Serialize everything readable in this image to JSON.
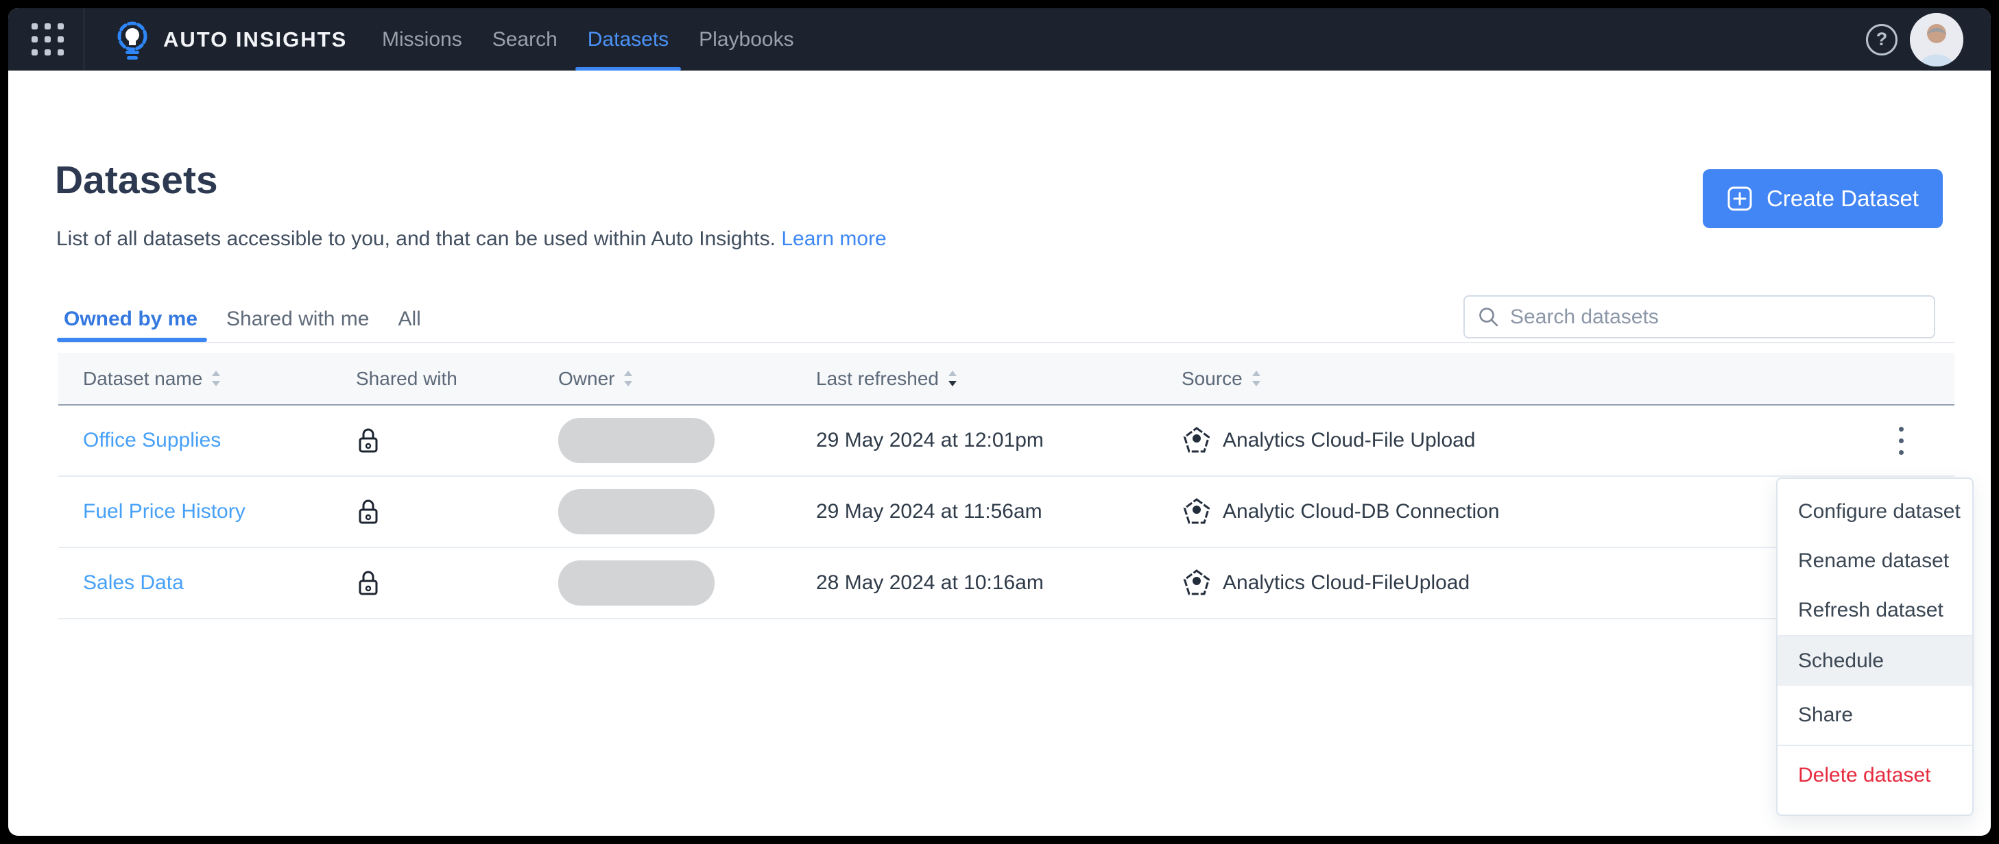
{
  "navbar": {
    "brand": "AUTO INSIGHTS",
    "items": [
      {
        "label": "Missions",
        "active": false
      },
      {
        "label": "Search",
        "active": false
      },
      {
        "label": "Datasets",
        "active": true
      },
      {
        "label": "Playbooks",
        "active": false
      }
    ],
    "icons": {
      "launcher": "grid-dots",
      "logo": "lightbulb",
      "help": "question-circle",
      "avatar": "user-photo"
    }
  },
  "page": {
    "title": "Datasets",
    "subtitle": "List of all datasets accessible to you, and that can be used within Auto Insights.",
    "learn_more_label": "Learn more",
    "create_button_label": "Create Dataset",
    "create_button_icon": "plus-square"
  },
  "tabs": [
    {
      "label": "Owned by me",
      "active": true
    },
    {
      "label": "Shared with me",
      "active": false
    },
    {
      "label": "All",
      "active": false
    }
  ],
  "search": {
    "placeholder": "Search datasets",
    "icon": "magnifier"
  },
  "table": {
    "columns": [
      {
        "label": "Dataset name",
        "sortable": true,
        "sort": "none"
      },
      {
        "label": "Shared with",
        "sortable": false,
        "sort": "none"
      },
      {
        "label": "Owner",
        "sortable": true,
        "sort": "none"
      },
      {
        "label": "Last refreshed",
        "sortable": true,
        "sort": "desc"
      },
      {
        "label": "Source",
        "sortable": true,
        "sort": "none"
      }
    ],
    "rows": [
      {
        "name": "Office Supplies",
        "shared_icon": "lock",
        "owner_redacted": true,
        "last_refreshed": "29 May 2024 at 12:01pm",
        "source_icon": "pentagon",
        "source": "Analytics Cloud-File Upload",
        "actions_icon": "kebab-vertical"
      },
      {
        "name": "Fuel Price History",
        "shared_icon": "lock",
        "owner_redacted": true,
        "last_refreshed": "29 May 2024 at 11:56am",
        "source_icon": "pentagon",
        "source": "Analytic Cloud-DB Connection"
      },
      {
        "name": "Sales Data",
        "shared_icon": "lock",
        "owner_redacted": true,
        "last_refreshed": "28 May 2024 at 10:16am",
        "source_icon": "pentagon",
        "source": "Analytics Cloud-FileUpload"
      }
    ]
  },
  "context_menu": {
    "items": [
      {
        "label": "Configure dataset"
      },
      {
        "label": "Rename dataset"
      },
      {
        "label": "Refresh dataset"
      },
      {
        "label": "Schedule",
        "highlighted": true
      },
      {
        "label": "Share"
      },
      {
        "label": "Delete dataset",
        "danger": true
      }
    ]
  },
  "colors": {
    "navbar_bg": "#1c232e",
    "accent_blue": "#3d87f5",
    "button_blue": "#4285f4",
    "link_blue": "#46a0f7",
    "danger_red": "#e62b3f",
    "title_text": "#2d3950",
    "header_band": "#f6f8fa",
    "redacted_pill": "#d3d4d6",
    "menu_highlight": "#eef1f4"
  }
}
